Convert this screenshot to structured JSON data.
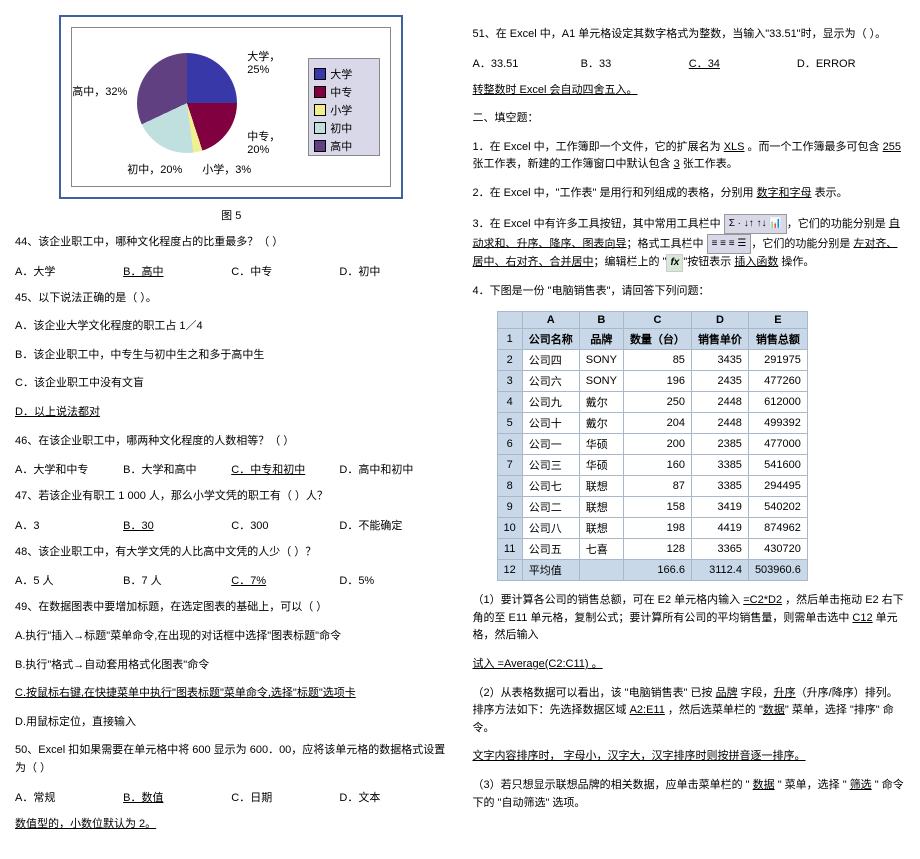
{
  "chart_data": {
    "type": "pie",
    "categories": [
      "大学",
      "中专",
      "小学",
      "初中",
      "高中"
    ],
    "values": [
      25,
      20,
      3,
      20,
      32
    ],
    "labels": [
      "大学，25%",
      "中专，20%",
      "小学，3%",
      "初中，20%",
      "高中，32%"
    ],
    "colors": [
      "#3838a8",
      "#800040",
      "#f0f090",
      "#c0e0e0",
      "#604080"
    ],
    "title": "图 5"
  },
  "left": {
    "caption": "图 5",
    "q44": "44、该企业职工中，哪种文化程度占的比重最多？（   ）",
    "q44a": "A．大学",
    "q44b": "B．高中",
    "q44c": "C．中专",
    "q44d": "D．初中",
    "q45": "45、以下说法正确的是（   ）。",
    "q45a": "A．该企业大学文化程度的职工占 1／4",
    "q45b": "B．该企业职工中，中专生与初中生之和多于高中生",
    "q45c": "C．该企业职工中没有文盲",
    "q45d": "D．以上说法都对",
    "q46": "46、在该企业职工中，哪两种文化程度的人数相等？（   ）",
    "q46a": "A．大学和中专",
    "q46b": "B．大学和高中",
    "q46c": "C．中专和初中",
    "q46d": "D．高中和初中",
    "q47": "47、若该企业有职工 1 000 人，那么小学文凭的职工有（    ）人？",
    "q47a": "A．3",
    "q47b": "B．30",
    "q47c": "C．300",
    "q47d": "D．不能确定",
    "q48": "48、该企业职工中，有大学文凭的人比高中文凭的人少（    ）？",
    "q48a": "A．5 人",
    "q48b": "B．7 人",
    "q48c": "C．7%",
    "q48d": "D．5%",
    "q49": "49、在数据图表中要增加标题，在选定图表的基础上，可以（   ）",
    "q49a": "A.执行\"插入→标题\"菜单命令,在出现的对话框中选择\"图表标题\"命令",
    "q49b": "B.执行\"格式→自动套用格式化图表\"命令",
    "q49c": "C.按鼠标右键,在快捷菜单中执行\"图表标题\"菜单命令,选择\"标题\"选项卡",
    "q49d": "D.用鼠标定位，直接输入",
    "q50": "50、Excel 扣如果需要在单元格中将 600 显示为 600．00，应将该单元格的数据格式设置为（   ）",
    "q50a": "A．常规",
    "q50b": "B．数值",
    "q50c": "C．日期",
    "q50d": "D．文本",
    "q50ans": "数值型的，小数位默认为 2。"
  },
  "right": {
    "q51": "51、在 Excel 中，A1 单元格设定其数字格式为整数，当输入\"33.51\"时，显示为（     ）。",
    "q51a": "A．33.51",
    "q51b": "B．33",
    "q51c": "C．34",
    "q51d": "D．ERROR",
    "q51ans": "转整数时 Excel 会自动四舍五入。",
    "fill_header": "二、填空题：",
    "f1a": "1．在 Excel 中，工作簿即一个文件，它的扩展名为 ",
    "f1b": "XLS",
    "f1c": " 。而一个工作簿最多可包含 ",
    "f1d": "255",
    "f1e": " 张工作表，新建的工作簿窗口中默认包含 ",
    "f1f": "3",
    "f1g": " 张工作表。",
    "f2a": "2．在 Excel 中，\"工作表\" 是用行和列组成的表格，分别用 ",
    "f2b": "数字和字母",
    "f2c": " 表示。",
    "f3a": "3．在 Excel 中有许多工具按钮，其中常用工具栏中 ",
    "f3b": "，它们的功能分别是 ",
    "f3c": "自动求和、升序、降序、图表向导",
    "f3d": "；格式工具栏中 ",
    "f3e": "，它们的功能分别是 ",
    "f3f": "左对齐、居中、右对齐、合并居中",
    "f3g": "；编辑栏上的 \"",
    "f3h": "\"按钮表示 ",
    "f3i": "插入函数",
    "f3j": " 操作。",
    "f4": "4．下图是一份 \"电脑销售表\"，请回答下列问题：",
    "p1a": "（1）要计算各公司的销售总额，可在 E2 单元格内输入 ",
    "p1b": "=C2*D2",
    "p1c": " ，然后单击拖动 E2 右下角的至 E11 单元格，复制公式；要计算所有公司的平均销售量，则需单击选中 ",
    "p1d": "C12",
    "p1e": " 单元格，然后输入",
    "p1f": "试入 =Average(C2:C11)  。",
    "p2a": "（2）从表格数据可以看出，该 \"电脑销售表\" 已按 ",
    "p2b": "品牌",
    "p2c": " 字段，",
    "p2d": "升序",
    "p2e": "（升序/降序）排列。排序方法如下：先选择数据区域 ",
    "p2f": "A2:E11",
    "p2g": " ，然后选菜单栏的 \"",
    "p2h": "数据",
    "p2i": "\" 菜单，选择 \"排序\" 命令。",
    "p2j": "文字内容排序时， 字母小，汉字大，汉字排序时则按拼音逐一排序。",
    "p3a": "（3）若只想显示联想品牌的相关数据，应单击菜单栏的 \" ",
    "p3b": "数据",
    "p3c": " \" 菜单，选择 \" ",
    "p3d": "筛选",
    "p3e": " \" 命令下的 \"自动筛选\" 选项。"
  },
  "table": {
    "cols": [
      "",
      "A",
      "B",
      "C",
      "D",
      "E"
    ],
    "header": [
      "公司名称",
      "品牌",
      "数量（台）",
      "销售单价",
      "销售总额"
    ],
    "rows": [
      [
        "1",
        "公司名称",
        "品牌",
        "数量（台）",
        "销售单价",
        "销售总额"
      ],
      [
        "2",
        "公司四",
        "SONY",
        "85",
        "3435",
        "291975"
      ],
      [
        "3",
        "公司六",
        "SONY",
        "196",
        "2435",
        "477260"
      ],
      [
        "4",
        "公司九",
        "戴尔",
        "250",
        "2448",
        "612000"
      ],
      [
        "5",
        "公司十",
        "戴尔",
        "204",
        "2448",
        "499392"
      ],
      [
        "6",
        "公司一",
        "华硕",
        "200",
        "2385",
        "477000"
      ],
      [
        "7",
        "公司三",
        "华硕",
        "160",
        "3385",
        "541600"
      ],
      [
        "8",
        "公司七",
        "联想",
        "87",
        "3385",
        "294495"
      ],
      [
        "9",
        "公司二",
        "联想",
        "158",
        "3419",
        "540202"
      ],
      [
        "10",
        "公司八",
        "联想",
        "198",
        "4419",
        "874962"
      ],
      [
        "11",
        "公司五",
        "七喜",
        "128",
        "3365",
        "430720"
      ],
      [
        "12",
        "平均值",
        "",
        "166.6",
        "3112.4",
        "503960.6"
      ]
    ]
  },
  "tbimg1": "Σ · ↓↑ ↑↓ 📊",
  "tbimg2": "≡ ≡ ≡ ☰",
  "fx": "fx"
}
